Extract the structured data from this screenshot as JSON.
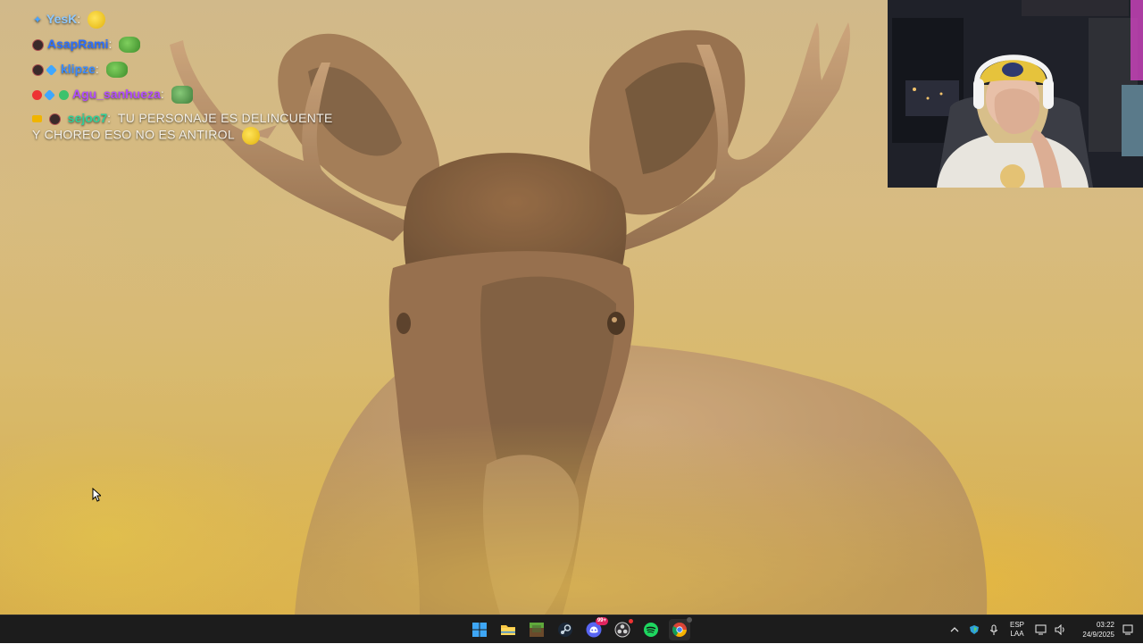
{
  "chat": {
    "messages": [
      {
        "user": "YesK",
        "user_color": "#8ec8ff",
        "text": ""
      },
      {
        "user": "AsapRami",
        "user_color": "#2b6fff",
        "text": ""
      },
      {
        "user": "klipze",
        "user_color": "#3b8cff",
        "text": ""
      },
      {
        "user": "Agu_sanhueza",
        "user_color": "#b14cff",
        "text": ""
      },
      {
        "user": "sejoo7",
        "user_color": "#2fcf9a",
        "text": "TU PERSONAJE ES DELINCUENTE Y CHOREO ESO NO ES ANTIROL"
      }
    ],
    "separator": ":"
  },
  "taskbar": {
    "apps": [
      {
        "name": "start",
        "icon": "windows-logo-icon"
      },
      {
        "name": "file-explorer",
        "icon": "folder-icon"
      },
      {
        "name": "minecraft",
        "icon": "grass-block-icon"
      },
      {
        "name": "steam",
        "icon": "steam-icon"
      },
      {
        "name": "discord",
        "icon": "discord-icon",
        "badge": "99+"
      },
      {
        "name": "obs",
        "icon": "obs-icon"
      },
      {
        "name": "spotify",
        "icon": "spotify-icon"
      },
      {
        "name": "chrome",
        "icon": "chrome-icon"
      }
    ],
    "language": {
      "line1": "ESP",
      "line2": "LAA"
    },
    "clock": {
      "time": "03:22",
      "date": "24/9/2025"
    }
  },
  "colors": {
    "taskbar_bg": "#1c1c1c",
    "wallpaper_main": "#d6b980"
  }
}
